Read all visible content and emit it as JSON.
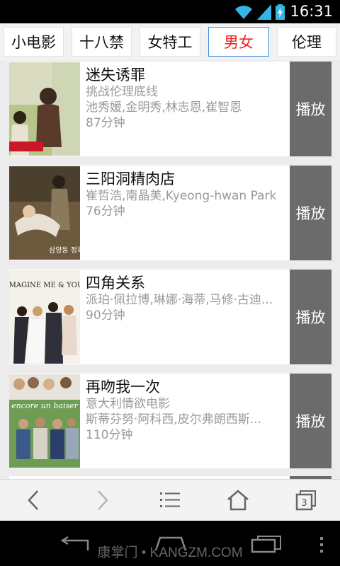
{
  "status_bar": {
    "time": "16:31"
  },
  "tabs": [
    {
      "label": "小电影",
      "active": false
    },
    {
      "label": "十八禁",
      "active": false
    },
    {
      "label": "女特工",
      "active": false
    },
    {
      "label": "男女",
      "active": true
    },
    {
      "label": "伦理",
      "active": false
    }
  ],
  "movies": [
    {
      "title": "迷失诱罪",
      "tagline": "挑战伦理底线",
      "cast": "池秀媛,金明秀,林志恩,崔智恩",
      "duration": "87分钟",
      "play_label": "播放"
    },
    {
      "title": "三阳洞精肉店",
      "tagline": "",
      "cast": "崔哲浩,南晶美,Kyeong-hwan Park",
      "duration": "76分钟",
      "play_label": "播放"
    },
    {
      "title": "四角关系",
      "tagline": "",
      "cast": "派珀·佩拉博,琳娜·海蒂,马修·古迪...",
      "duration": "90分钟",
      "play_label": "播放"
    },
    {
      "title": "再吻我一次",
      "tagline": "意大利情欲电影",
      "cast": "斯蒂芬努·阿科西,皮尔弗朗西斯...",
      "duration": "110分钟",
      "play_label": "播放"
    }
  ],
  "posters": {
    "p2_text": "삼양동 정육점",
    "p3_text": "IMAGINE ME & YOU",
    "p4_text": "encore un baiser"
  },
  "toolbar": {
    "tab_count": "3"
  },
  "watermark": "康掌门 • KANGZM.COM",
  "colors": {
    "accent_red": "#e22222",
    "tab_border_active": "#3b8ede",
    "play_bg": "#6b6b6b"
  }
}
